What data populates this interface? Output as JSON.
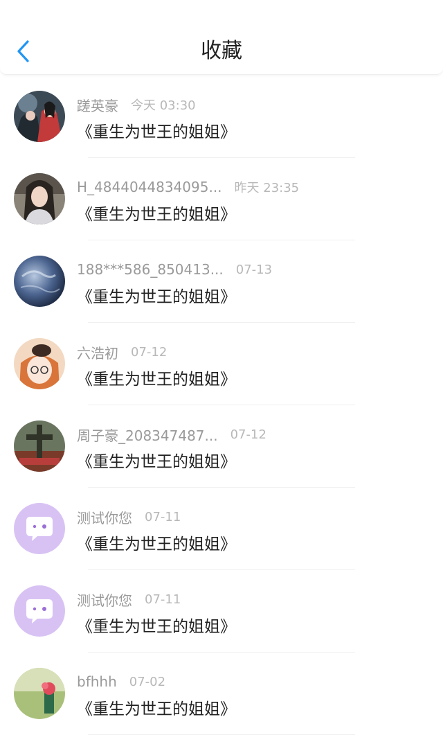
{
  "header": {
    "title": "收藏",
    "back_icon": "chevron-left-icon",
    "accent": "#2196f3"
  },
  "items": [
    {
      "name": "蹉英豪",
      "time": "今天 03:30",
      "book": "《重生为世王的姐姐》",
      "avatar": "anime-couple"
    },
    {
      "name": "H_4844044834095...",
      "time": "昨天 23:35",
      "book": "《重生为世王的姐姐》",
      "avatar": "woman-photo"
    },
    {
      "name": "188***586_850413...",
      "time": "07-13",
      "book": "《重生为世王的姐姐》",
      "avatar": "earth-globe"
    },
    {
      "name": "六浩初",
      "time": "07-12",
      "book": "《重生为世王的姐姐》",
      "avatar": "anime-girl-hat"
    },
    {
      "name": "周子豪_208347487...",
      "time": "07-12",
      "book": "《重生为世王的姐姐》",
      "avatar": "cross-picture"
    },
    {
      "name": "测试你您",
      "time": "07-11",
      "book": "《重生为世王的姐姐》",
      "avatar": "default-chat"
    },
    {
      "name": "测试你您",
      "time": "07-11",
      "book": "《重生为世王的姐姐》",
      "avatar": "default-chat"
    },
    {
      "name": "bfhhh",
      "time": "07-02",
      "book": "《重生为世王的姐姐》",
      "avatar": "flower-photo"
    }
  ]
}
